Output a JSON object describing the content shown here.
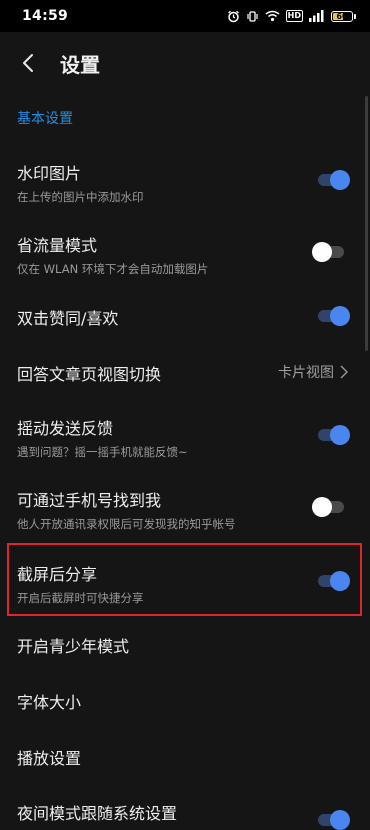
{
  "status_bar": {
    "time": "14:59",
    "hd": "HD",
    "battery": "60",
    "battery_level_percent": 60
  },
  "header": {
    "title": "设置",
    "back_icon": "chevron-left-icon"
  },
  "section": {
    "label": "基本设置"
  },
  "settings": [
    {
      "key": "watermark",
      "title": "水印图片",
      "subtitle": "在上传的图片中添加水印",
      "control": "toggle",
      "state": "on"
    },
    {
      "key": "data_saver",
      "title": "省流量模式",
      "subtitle": "仅在 WLAN 环境下才会自动加载图片",
      "control": "toggle",
      "state": "off"
    },
    {
      "key": "double_tap_like",
      "title": "双击赞同/喜欢",
      "subtitle": "",
      "control": "toggle",
      "state": "on"
    },
    {
      "key": "answer_view",
      "title": "回答文章页视图切换",
      "subtitle": "",
      "control": "value",
      "value": "卡片视图"
    },
    {
      "key": "shake_feedback",
      "title": "摇动发送反馈",
      "subtitle": "遇到问题？摇一摇手机就能反馈~",
      "control": "toggle",
      "state": "on"
    },
    {
      "key": "find_by_phone",
      "title": "可通过手机号找到我",
      "subtitle": "他人开放通讯录权限后可发现我的知乎帐号",
      "control": "toggle",
      "state": "off"
    },
    {
      "key": "screenshot_share",
      "title": "截屏后分享",
      "subtitle": "开启后截屏时可快捷分享",
      "control": "toggle",
      "state": "on"
    },
    {
      "key": "youth_mode",
      "title": "开启青少年模式",
      "subtitle": "",
      "control": "none"
    },
    {
      "key": "font_size",
      "title": "字体大小",
      "subtitle": "",
      "control": "none"
    },
    {
      "key": "playback",
      "title": "播放设置",
      "subtitle": "",
      "control": "none"
    },
    {
      "key": "night_mode_system",
      "title": "夜间模式跟随系统设置",
      "subtitle": "",
      "control": "toggle",
      "state": "on"
    }
  ],
  "colors": {
    "accent": "#1f8fe0",
    "toggle_on": "#4a86f0",
    "highlight": "#e0242b",
    "background": "#151515"
  }
}
